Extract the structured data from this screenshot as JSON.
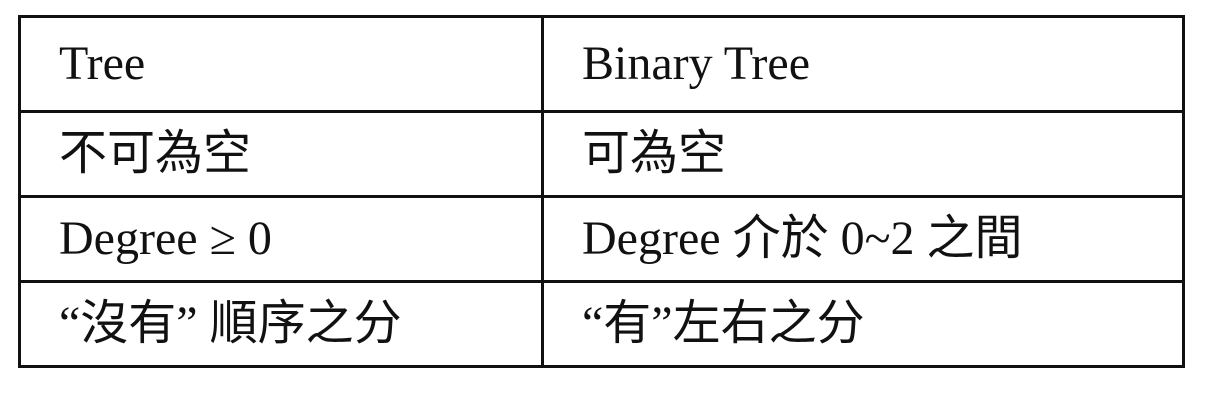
{
  "table": {
    "headers": [
      "Tree",
      "Binary Tree"
    ],
    "rows": [
      [
        "不可為空",
        "可為空"
      ],
      [
        "Degree ≥ 0",
        "Degree 介於 0~2 之間"
      ],
      [
        "“沒有” 順序之分",
        "“有”左右之分"
      ]
    ]
  }
}
